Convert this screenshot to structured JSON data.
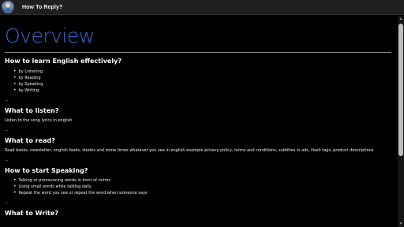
{
  "window": {
    "title": "How To Reply?",
    "icon": "avatar-icon"
  },
  "page": {
    "heading": "Overview",
    "sections": [
      {
        "title": "How to learn English effectively?",
        "items": [
          "by Listening",
          "by Reading",
          "by Speaking",
          "by Writing"
        ],
        "separator": "..."
      },
      {
        "title": "What to listen?",
        "text": "Listen to the song lyrics in english",
        "separator": "..."
      },
      {
        "title": "What to read?",
        "text": "Read books, newsletter, english feeds, stories and some times whatever you see in english example privacy policy, terms and conditions, subtitles in ads, Hash tags, product descriptions",
        "separator": "..."
      },
      {
        "title": "How to start Speaking?",
        "items": [
          "Talking or pronouncing words in front of mirror.",
          "Using small words while talking daily",
          "Repeat the word you see or repeat the word when someone says"
        ],
        "separator": "..."
      },
      {
        "title": "What to Write?"
      }
    ]
  },
  "scrollbar": {
    "up_glyph": "▲",
    "down_glyph": "▼"
  },
  "colors": {
    "heading": "#3a67d6",
    "background": "#000000",
    "titlebar": "#1f1f1f"
  }
}
